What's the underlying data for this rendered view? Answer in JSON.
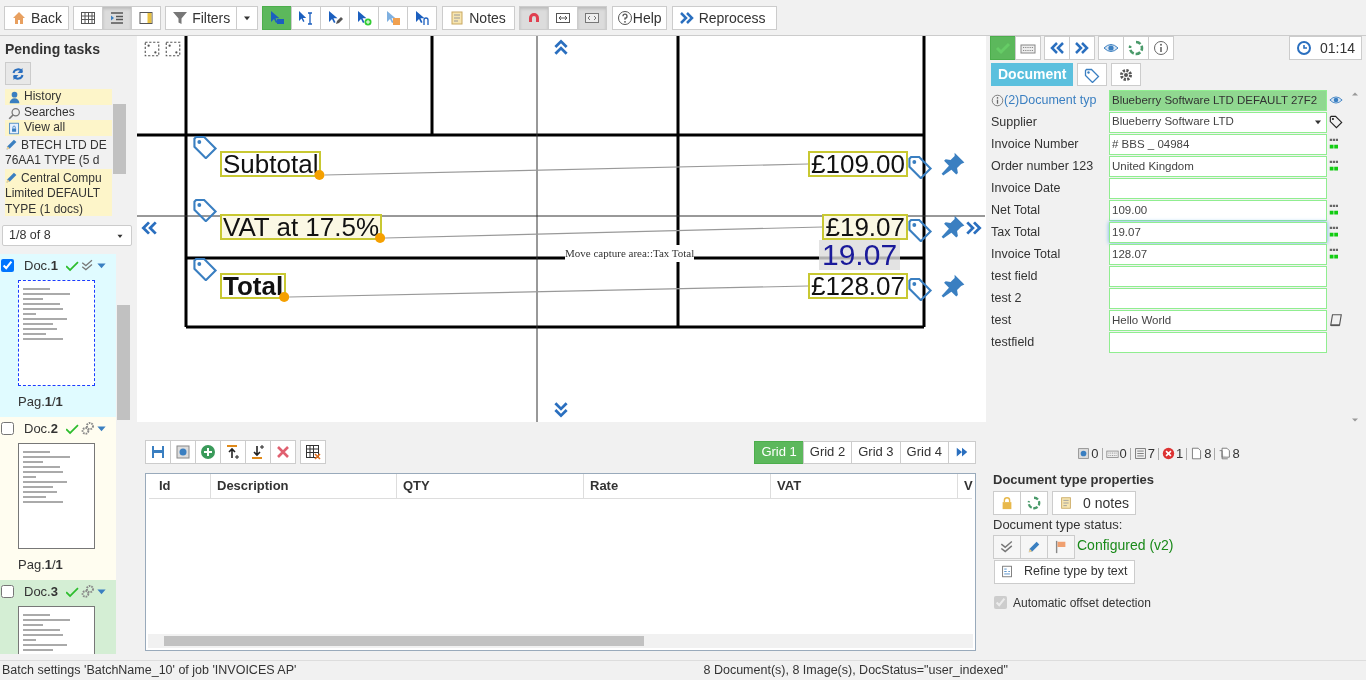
{
  "toolbar": {
    "back": "Back",
    "view_modes": [
      {
        "selected": false
      },
      {
        "selected": true
      },
      {
        "selected": false
      }
    ],
    "filters": "Filters",
    "capture_tools": [
      {
        "selected": true
      },
      {
        "selected": false
      },
      {
        "selected": false
      },
      {
        "selected": false
      },
      {
        "selected": false
      },
      {
        "selected": false
      }
    ],
    "notes": "Notes",
    "display_toggles": [
      {
        "selected": true
      },
      {
        "selected": false
      },
      {
        "selected": true
      }
    ],
    "help": "Help",
    "reprocess": "Reprocess"
  },
  "pending_tasks": {
    "title": "Pending tasks",
    "items": [
      {
        "kind": "history",
        "lines": [
          "History"
        ],
        "highlighted": true
      },
      {
        "kind": "search",
        "lines": [
          "Searches"
        ],
        "highlighted": false
      },
      {
        "kind": "view_all",
        "lines": [
          "View all"
        ],
        "highlighted": true
      },
      {
        "kind": "batch",
        "lines": [
          "BTECH LTD DE",
          "76AA1 TYPE (5 d"
        ],
        "highlighted": false
      },
      {
        "kind": "batch",
        "lines": [
          "Central Compu",
          "Limited DEFAULT",
          "TYPE (1 docs)"
        ],
        "highlighted": true
      }
    ]
  },
  "pager": "1/8 of 8",
  "documents": [
    {
      "name": "Doc.**1**",
      "checked": true,
      "selected": true,
      "kind": "verified",
      "color": "#e0fbff",
      "pages": "Pag.**1**/**1**"
    },
    {
      "name": "Doc.**2**",
      "checked": false,
      "selected": false,
      "kind": "processing",
      "color": "#fffdf0",
      "pages": "Pag.**1**/**1**"
    },
    {
      "name": "Doc.**3**",
      "checked": false,
      "selected": false,
      "kind": "processing",
      "color": "#d4eed4"
    }
  ],
  "viewer": {
    "captures": [
      {
        "label": "Subtotal",
        "label_bold": false,
        "value": "£109.00",
        "active": false
      },
      {
        "label": "VAT at 17.5%",
        "label_bold": false,
        "value": "£19.07",
        "active": true
      },
      {
        "label": "Total",
        "label_bold": true,
        "value": "£128.07",
        "active": false
      }
    ],
    "tooltip": "Move capture area::Tax Total",
    "preview": "19.07"
  },
  "grid": {
    "tabs": [
      {
        "label": "Grid 1",
        "selected": true
      },
      {
        "label": "Grid 2",
        "selected": false
      },
      {
        "label": "Grid 3",
        "selected": false
      },
      {
        "label": "Grid 4",
        "selected": false
      }
    ],
    "columns": [
      "Id",
      "Description",
      "QTY",
      "Rate",
      "VAT",
      "V"
    ]
  },
  "right": {
    "timer": "01:14",
    "tabs": [
      {
        "label": "Document",
        "selected": true
      },
      {
        "selected": false
      },
      {
        "selected": false
      }
    ],
    "fields": [
      {
        "kind": "doctype",
        "label": "(2)Document typ",
        "value": "Blueberry Software LTD DEFAULT 27F2",
        "ocr": false,
        "focused": false
      },
      {
        "kind": "select",
        "label": "Supplier",
        "value": "Blueberry Software LTD",
        "ocr": false,
        "focused": false
      },
      {
        "kind": "text",
        "label": "Invoice Number",
        "value": "# BBS _ 04984",
        "ocr": true,
        "focused": false
      },
      {
        "kind": "text",
        "label": "Order number 123",
        "value": "United Kingdom",
        "ocr": true,
        "focused": false
      },
      {
        "kind": "text",
        "label": "Invoice Date",
        "ocr": false,
        "focused": false
      },
      {
        "kind": "text",
        "label": "Net Total",
        "value": "109.00",
        "ocr": true,
        "focused": false
      },
      {
        "kind": "text",
        "label": "Tax Total",
        "value": "19.07",
        "ocr": true,
        "focused": true
      },
      {
        "kind": "text",
        "label": "Invoice Total",
        "value": "128.07",
        "ocr": true,
        "focused": false
      },
      {
        "kind": "text",
        "label": "test field",
        "ocr": false,
        "focused": false
      },
      {
        "kind": "text",
        "label": "test 2",
        "ocr": false,
        "focused": false
      },
      {
        "kind": "memo",
        "label": "test",
        "value": "Hello World",
        "ocr": false,
        "focused": false
      },
      {
        "kind": "text",
        "label": "testfield",
        "ocr": false,
        "focused": false
      }
    ],
    "counters": [
      "0",
      "0",
      "7",
      "1",
      "8",
      "8"
    ],
    "properties": {
      "title": "Document type properties",
      "notes": "0 notes",
      "status_label": "Document type status:",
      "status": "Configured (v2)",
      "refine": "Refine type by text",
      "offset": {
        "label": "Automatic offset detection",
        "checked": true,
        "disabled": true
      }
    }
  },
  "status_bar": {
    "left": "Batch settings 'BatchName_10' of job 'INVOICES AP'",
    "right": "8 Document(s), 8 Image(s), DocStatus=\"user_indexed\""
  }
}
